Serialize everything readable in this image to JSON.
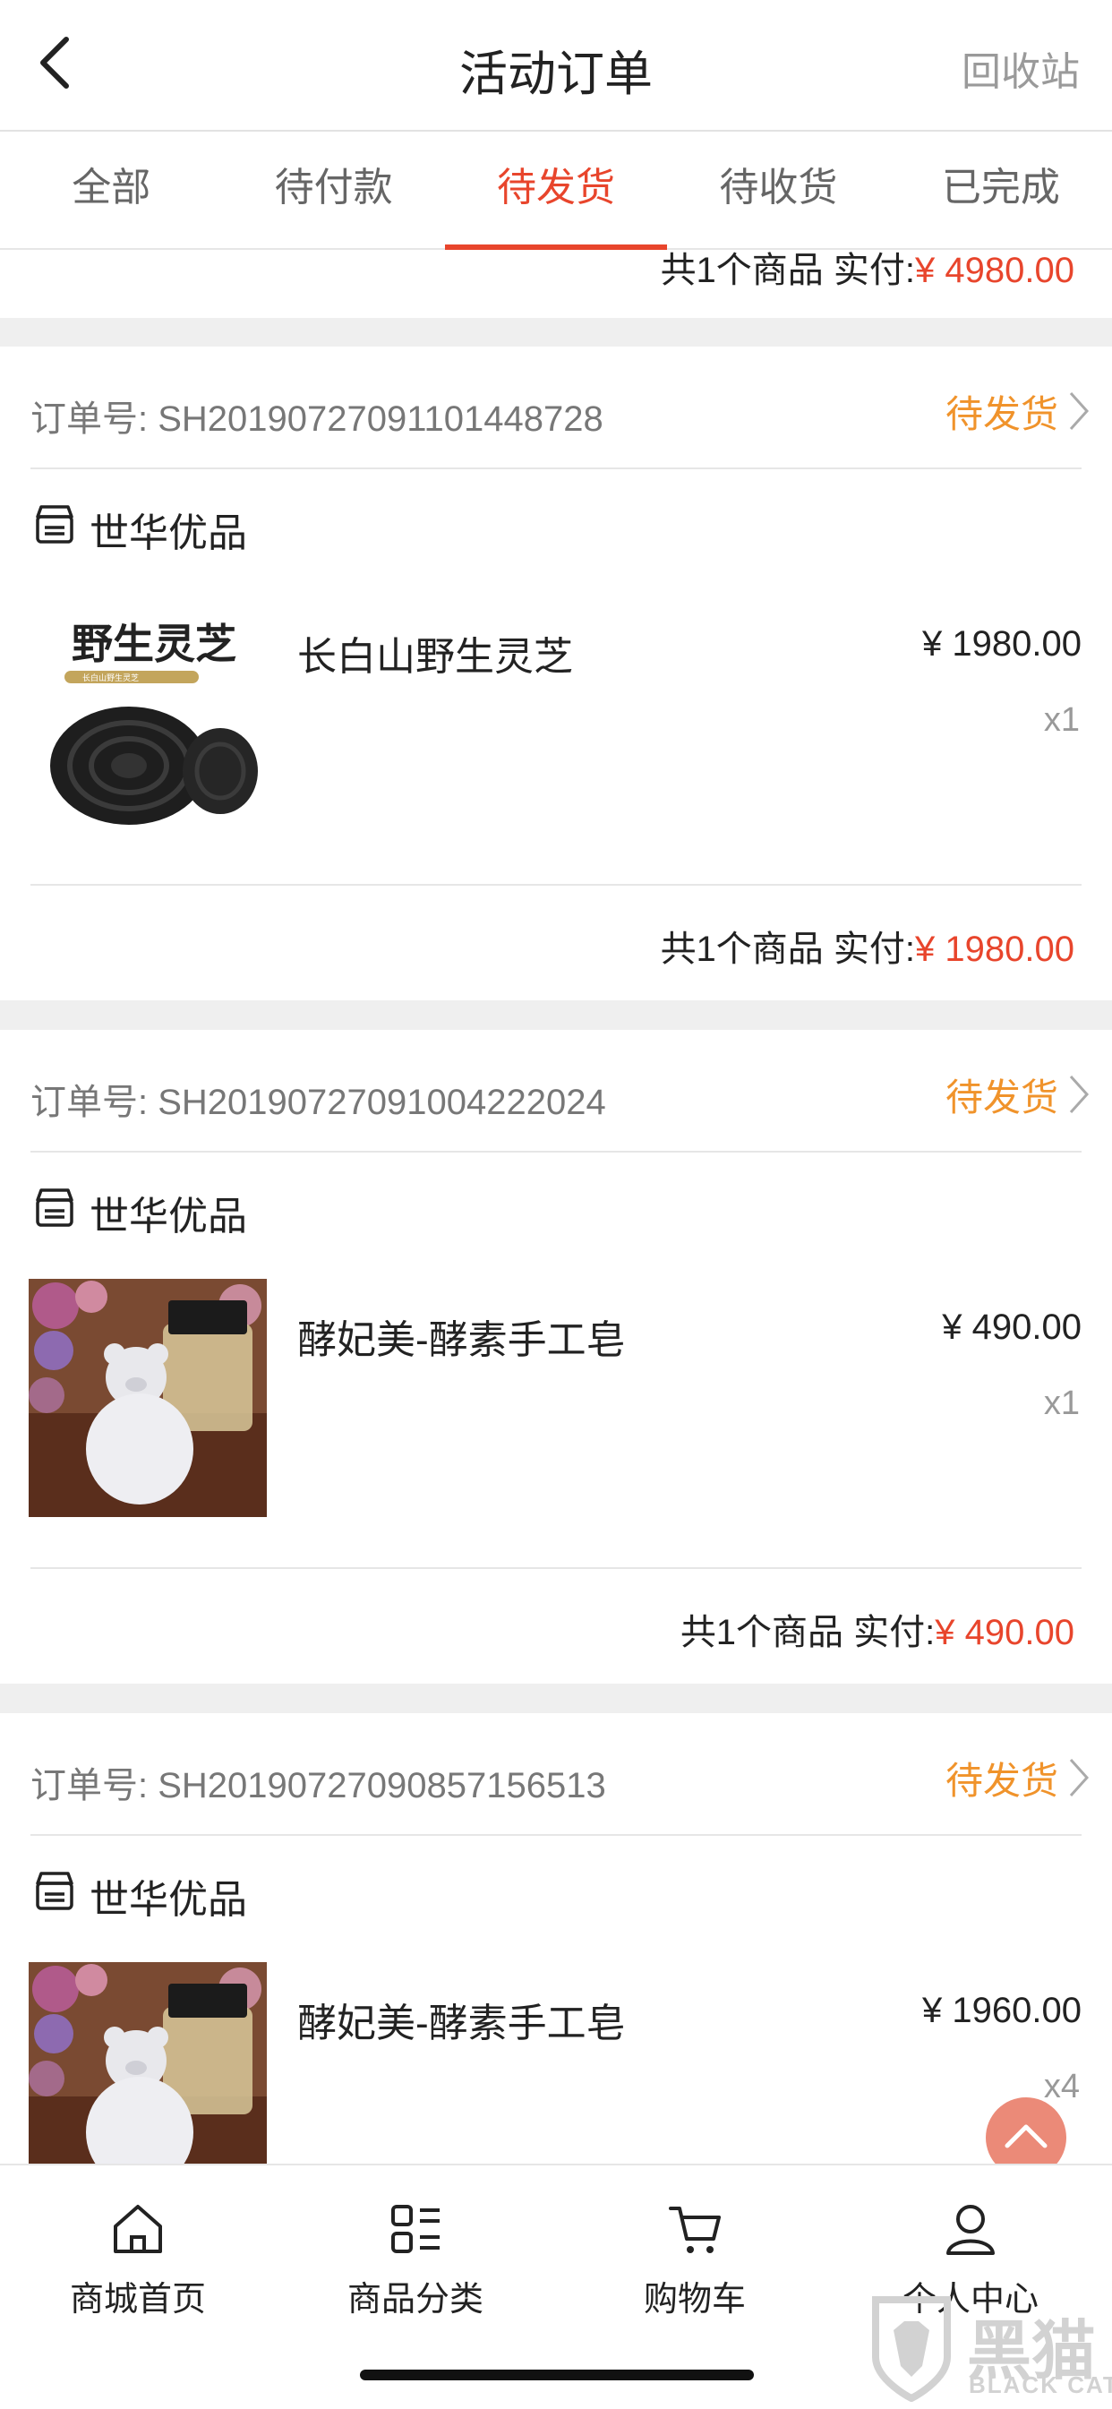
{
  "header": {
    "title": "活动订单",
    "recycle_label": "回收站"
  },
  "tabs": [
    {
      "label": "全部"
    },
    {
      "label": "待付款"
    },
    {
      "label": "待发货",
      "active": true
    },
    {
      "label": "待收货"
    },
    {
      "label": "已完成"
    }
  ],
  "partial_order": {
    "summary": "共1个商品 实付:",
    "total": "¥ 4980.00"
  },
  "orders": [
    {
      "order_label": "订单号: SH20190727091101448728",
      "status": "待发货",
      "store": "世华优品",
      "product_name": "长白山野生灵芝",
      "price": "¥ 1980.00",
      "qty": "x1",
      "summary": "共1个商品 实付:",
      "total": "¥ 1980.00",
      "image_text": "野生灵芝",
      "image_subtext": "长白山野生灵芝"
    },
    {
      "order_label": "订单号: SH20190727091004222024",
      "status": "待发货",
      "store": "世华优品",
      "product_name": "酵妃美-酵素手工皂",
      "price": "¥ 490.00",
      "qty": "x1",
      "summary": "共1个商品 实付:",
      "total": "¥ 490.00"
    },
    {
      "order_label": "订单号: SH20190727090857156513",
      "status": "待发货",
      "store": "世华优品",
      "product_name": "酵妃美-酵素手工皂",
      "price": "¥ 1960.00",
      "qty": "x4"
    }
  ],
  "bottom_nav": [
    {
      "label": "商城首页",
      "icon": "home-icon"
    },
    {
      "label": "商品分类",
      "icon": "category-icon"
    },
    {
      "label": "购物车",
      "icon": "cart-icon"
    },
    {
      "label": "个人中心",
      "icon": "user-icon"
    }
  ],
  "watermark": {
    "cn": "黑猫",
    "en": "BLACK CAT"
  },
  "colors": {
    "accent_red": "#e8452c",
    "status_orange": "#f0932b",
    "scroll_button": "#eb8a78"
  }
}
